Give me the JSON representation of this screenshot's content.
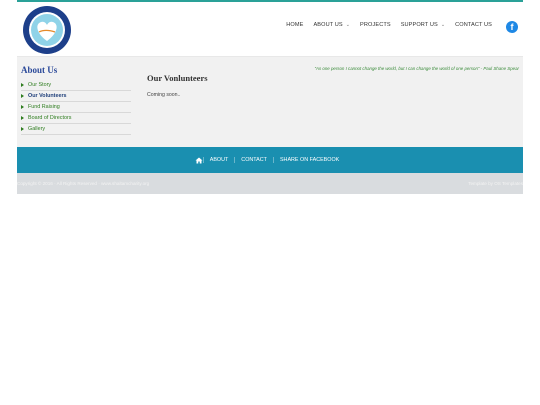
{
  "header": {
    "logo_alt": "Shaltam Charity logo",
    "nav": [
      {
        "label": "HOME",
        "has_caret": false
      },
      {
        "label": "ABOUT US",
        "has_caret": true
      },
      {
        "label": "PROJECTS",
        "has_caret": false
      },
      {
        "label": "SUPPORT US",
        "has_caret": true
      },
      {
        "label": "CONTACT US",
        "has_caret": false
      }
    ],
    "facebook_glyph": "f"
  },
  "sidebar": {
    "title": "About Us",
    "items": [
      {
        "label": "Our Story",
        "active": false
      },
      {
        "label": "Our Volunteers",
        "active": true
      },
      {
        "label": "Fund Raising",
        "active": false
      },
      {
        "label": "Board of Directors",
        "active": false
      },
      {
        "label": "Gallery",
        "active": false
      }
    ]
  },
  "main": {
    "quote": "\"As one person I cannot change the world, but I can change the world of one person\" - Paul Shane Spear",
    "title": "Our Vonlunteers",
    "body": "Coming soon.."
  },
  "footer": {
    "links": [
      "ABOUT",
      "CONTACT",
      "SHARE ON FACEBOOK"
    ],
    "copyright": "Copyright © 2016 · All Rights Reserved · www.shaltamcharity.org",
    "credit": "Template by OS Templates"
  },
  "colors": {
    "accent": "#1a8fb0",
    "sidebar_link": "#2e7d1f",
    "sidebar_title": "#2c4a9a"
  }
}
